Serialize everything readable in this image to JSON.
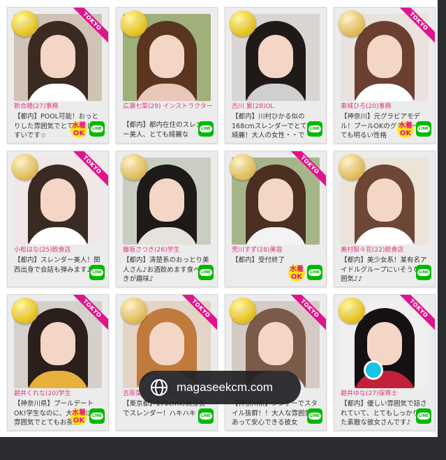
{
  "colors": {
    "pink": "#e0387a",
    "tokyo_ribbon": "#e0138c",
    "line_green": "#00b900",
    "badge_gold": "#f0d23a"
  },
  "cards": [
    {
      "badge": "Premium",
      "tokyo": "TOKYO",
      "name": "新合穂(27)事務",
      "desc": "【都内】POOL可能！おっとりした雰囲気でとても話しやすいです☆",
      "swim": true,
      "line": "LINE",
      "bg": "#cfc3b6",
      "hair": "#3b2a22",
      "body": "#ffffff"
    },
    {
      "badge": "Premium",
      "tokyo": "",
      "name": "広瀬七菜(29) インストラクター",
      "desc": "【都内】都内在住のスレンダー美人、とても綺麗な",
      "swim": false,
      "line": "LINE",
      "bg": "#9fb07a",
      "hair": "#5b3520",
      "body": "#e9c7b9"
    },
    {
      "badge": "Premium",
      "tokyo": "",
      "name": "古川 累(28)OL",
      "desc": "【都内】川村ひかる似の168cmスレンダーでとても綺麗！大人の女性・・で",
      "swim": false,
      "line": "LINE",
      "bg": "#d9d5d2",
      "hair": "#1f1a18",
      "body": "#cfcfcf"
    },
    {
      "badge": "Reguler",
      "tokyo": "TOKYO",
      "name": "東城ひろ(20)事務",
      "desc": "【神奈川】元グラビアモデル！プールOKのグラマー♪とても明るい性格",
      "swim": true,
      "line": "LINE",
      "bg": "#e9e2df",
      "hair": "#6b4030",
      "body": "#ffffff"
    },
    {
      "badge": "Reguler",
      "tokyo": "TOKYO",
      "name": "小松はな(25)飲食店",
      "desc": "【都内】スレンダー美人！関西出身で会話も弾みます♪♪",
      "swim": false,
      "line": "LINE",
      "bg": "#f1e7e7",
      "hair": "#3a2a24",
      "body": "#ffffff"
    },
    {
      "badge": "Reguler",
      "tokyo": "",
      "name": "藤坂さつき(26)学生",
      "desc": "【都内】清楚系のおっとり美人さん♪お酒飲めます食べ歩きが趣味♪",
      "swim": false,
      "line": "LINE",
      "bg": "#c9cdc2",
      "hair": "#1e1a18",
      "body": "#e7e2dc"
    },
    {
      "badge": "Reguler",
      "tokyo": "TOKYO",
      "name": "荒川すず(28)美容",
      "desc": "【都内】受付終了",
      "swim": true,
      "line": "LINE",
      "bg": "#a6b68a",
      "hair": "#4a2f22",
      "body": "#f3f3f3"
    },
    {
      "badge": "Reguler",
      "tokyo": "",
      "name": "美村梨々花(22)飲食店",
      "desc": "【都内】美少女系！某有名アイドルグループにいそうな雰囲気♪♪",
      "swim": false,
      "line": "LINE",
      "bg": "#ece3d9",
      "hair": "#6d4635",
      "body": "#ffffff"
    },
    {
      "badge": "Premium",
      "tokyo": "TOKYO",
      "name": "碧井くれな(20)学生",
      "desc": "【神奈川県】プールデートOK!学生なのに、大人っぽい雰囲気でとてもお茶目",
      "swim": true,
      "line": "LINE",
      "bg": "#d6d0cc",
      "hair": "#2a1f1b",
      "body": "#e8b13c"
    },
    {
      "badge": "Reguler",
      "tokyo": "TOKYO",
      "name": "吉原菜々子(30)OL",
      "desc": "【東京都】170cmの高身長でスレンダー！ハキハキ",
      "swim": false,
      "line": "LINE",
      "bg": "#e3d4c6",
      "hair": "#c07a3e",
      "body": "#f1ece8"
    },
    {
      "badge": "Premium",
      "tokyo": "TOKYO",
      "name": "",
      "desc": "【神奈川県】シンデーでスタイル抜群！！大人な雰囲気があって安心できる彼女",
      "swim": false,
      "line": "LINE",
      "bg": "#d6cbc4",
      "hair": "#7a5a48",
      "body": "#e9e4df"
    },
    {
      "badge": "Premium",
      "tokyo": "TOKYO",
      "name": "碧井ゆな(27)保育士",
      "desc": "【都内】優しい雰囲気で話されていて、とてもしっかりした素敵な彼女さんです♪",
      "swim": false,
      "line": "LINE",
      "bg": "#f0eeee",
      "hair": "#151112",
      "body": "#c2203b"
    }
  ],
  "swim_text": {
    "l1": "水着",
    "l2": "OK"
  },
  "url_pill": {
    "text": "magaseekcm.com"
  }
}
